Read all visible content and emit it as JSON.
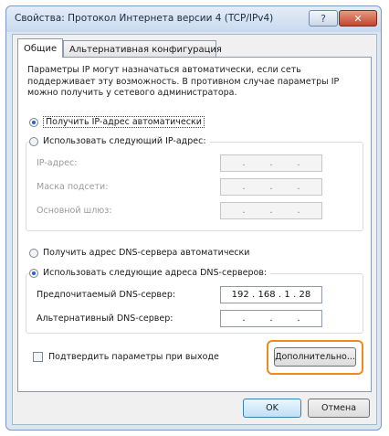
{
  "window": {
    "title": "Свойства: Протокол Интернета версии 4 (TCP/IPv4)",
    "help_label": "?",
    "close_label": "✕"
  },
  "tabs": [
    {
      "label": "Общие"
    },
    {
      "label": "Альтернативная конфигурация"
    }
  ],
  "general": {
    "description": "Параметры IP могут назначаться автоматически, если сеть поддерживает эту возможность. В противном случае параметры IP можно получить у сетевого администратора.",
    "ip_auto_label": "Получить IP-адрес автоматически",
    "ip_manual_label": "Использовать следующий IP-адрес:",
    "ip_auto_selected": true,
    "ip_fields": [
      {
        "label": "IP-адрес:",
        "value": ". . ."
      },
      {
        "label": "Маска подсети:",
        "value": ". . ."
      },
      {
        "label": "Основной шлюз:",
        "value": ". . ."
      }
    ],
    "dns_auto_label": "Получить адрес DNS-сервера автоматически",
    "dns_manual_label": "Использовать следующие адреса DNS-серверов:",
    "dns_manual_selected": true,
    "dns_fields": [
      {
        "label": "Предпочитаемый DNS-сервер:",
        "octets": [
          "192",
          "168",
          "1",
          "28"
        ]
      },
      {
        "label": "Альтернативный DNS-сервер:",
        "octets": [
          "",
          "",
          "",
          ""
        ]
      }
    ],
    "validate_label": "Подтвердить параметры при выходе",
    "advanced_label": "Дополнительно..."
  },
  "footer": {
    "ok_label": "OK",
    "cancel_label": "Отмена"
  },
  "colors": {
    "highlight": "#f08a1c",
    "radio_dot": "#2a62c9"
  }
}
